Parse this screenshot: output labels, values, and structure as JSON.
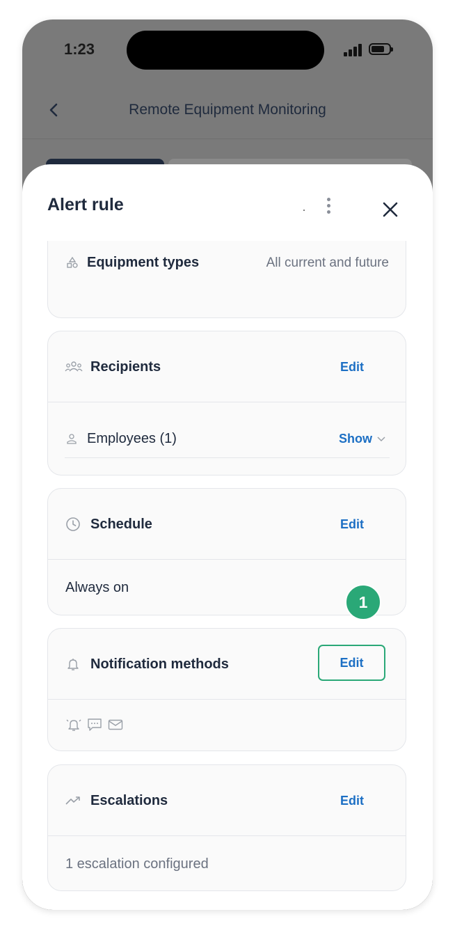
{
  "status_bar": {
    "time": "1:23"
  },
  "nav": {
    "title": "Remote Equipment Monitoring"
  },
  "sheet": {
    "title": "Alert rule",
    "equipment_types": {
      "label": "Equipment types",
      "value": "All current and future"
    },
    "recipients": {
      "label": "Recipients",
      "edit_label": "Edit",
      "employees_label": "Employees (1)",
      "show_label": "Show"
    },
    "schedule": {
      "label": "Schedule",
      "edit_label": "Edit",
      "value": "Always on"
    },
    "notification_methods": {
      "label": "Notification methods",
      "edit_label": "Edit",
      "icons": [
        "alarm-bell-icon",
        "chat-message-icon",
        "email-icon"
      ]
    },
    "escalations": {
      "label": "Escalations",
      "edit_label": "Edit",
      "value": "1 escalation configured"
    }
  },
  "annotation": {
    "badge": "1"
  },
  "colors": {
    "accent": "#1c6fc4",
    "highlight": "#2aa877",
    "text": "#1f2a3d",
    "muted": "#6b7280"
  }
}
